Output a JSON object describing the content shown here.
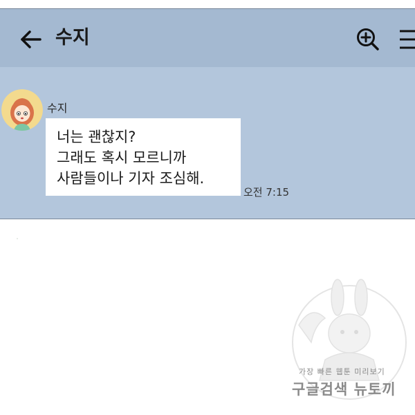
{
  "header": {
    "title": "수지",
    "back_icon": "arrow-left-icon",
    "search_icon": "zoom-in-icon",
    "menu_icon": "hamburger-menu-icon"
  },
  "message": {
    "sender": "수지",
    "lines": [
      "너는 괜찮지?",
      "그래도 혹시 모르니까",
      "사람들이나 기자 조심해."
    ],
    "time": "오전 7:15"
  },
  "watermark": {
    "line1": "가장 빠른 웹툰 미리보기",
    "line2": "구글검색 뉴토끼"
  },
  "colors": {
    "chat_background": "#b3c6dc",
    "header_background": "#a4b9d1",
    "bubble": "#ffffff"
  }
}
